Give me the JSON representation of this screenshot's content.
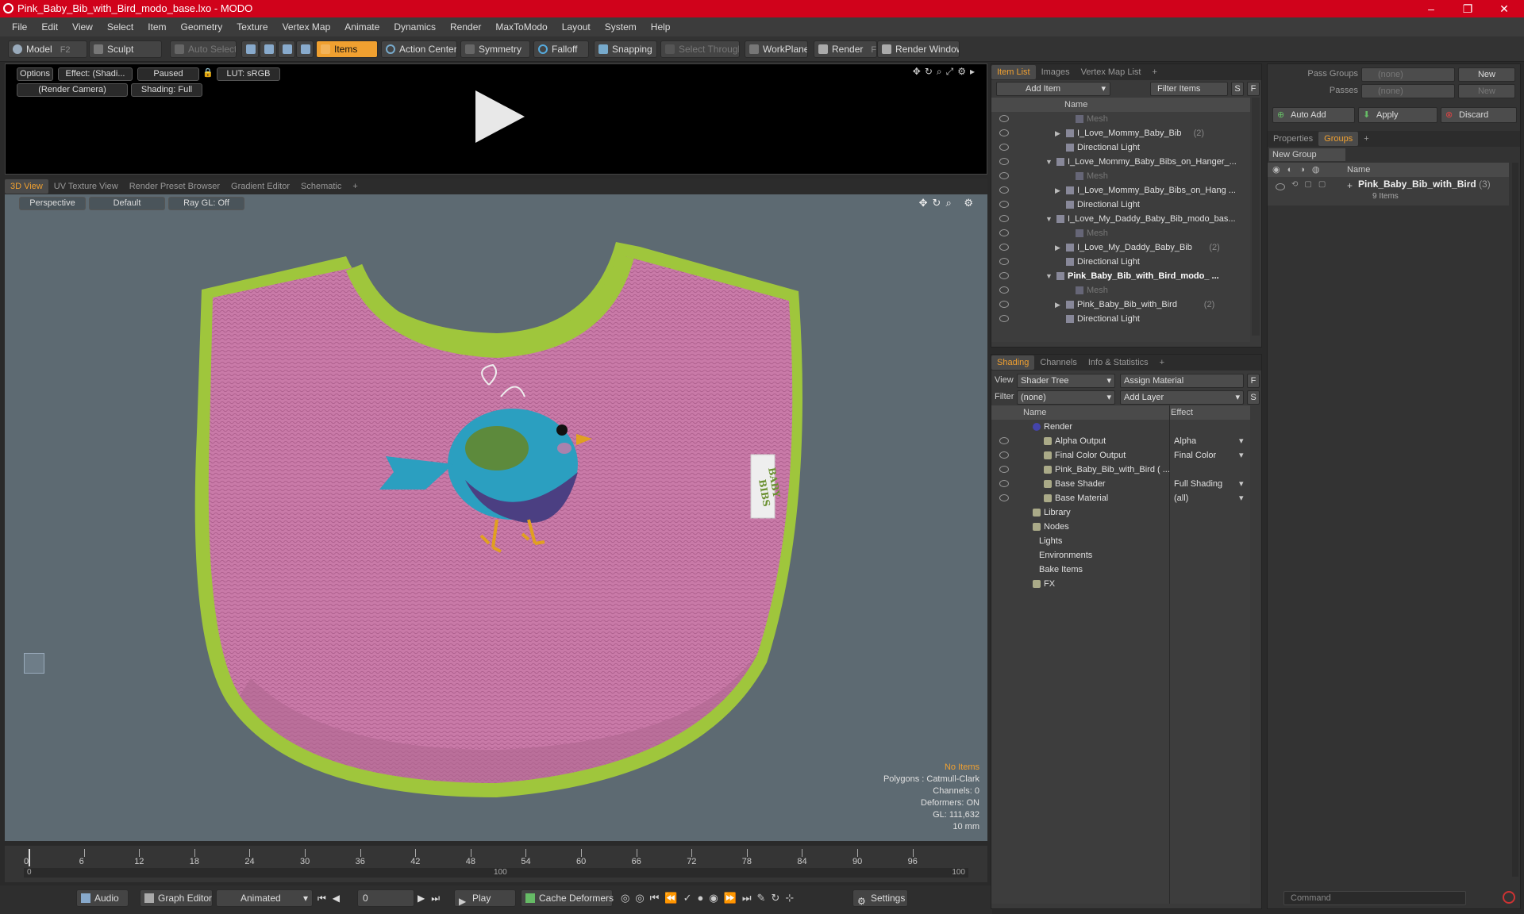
{
  "window": {
    "title": "Pink_Baby_Bib_with_Bird_modo_base.lxo - MODO"
  },
  "menu": [
    "File",
    "Edit",
    "View",
    "Select",
    "Item",
    "Geometry",
    "Texture",
    "Vertex Map",
    "Animate",
    "Dynamics",
    "Render",
    "MaxToModo",
    "Layout",
    "System",
    "Help"
  ],
  "toolbar": {
    "model": "Model",
    "model_key": "F2",
    "sculpt": "Sculpt",
    "auto_select": "Auto Select",
    "items": "Items",
    "action_center": "Action Center",
    "symmetry": "Symmetry",
    "falloff": "Falloff",
    "snapping": "Snapping",
    "select_through": "Select Through",
    "workplane": "WorkPlane",
    "render": "Render",
    "render_key": "F9",
    "render_window": "Render Window"
  },
  "preview": {
    "options": "Options",
    "effect": "Effect: (Shadi...",
    "paused": "Paused",
    "lut": "LUT: sRGB",
    "camera": "(Render Camera)",
    "shading": "Shading: Full"
  },
  "view_tabs": [
    "3D View",
    "UV Texture View",
    "Render Preset Browser",
    "Gradient Editor",
    "Schematic"
  ],
  "viewport": {
    "projection": "Perspective",
    "style": "Default",
    "raygl": "Ray GL: Off"
  },
  "bib": {
    "tag_line1": "BABY",
    "tag_line2": "BIBS",
    "bib_color": "#c97aa8",
    "trim_color": "#9fc63c",
    "bird_color": "#2b9fc0"
  },
  "hud": {
    "no_items": "No Items",
    "polygons": "Polygons : Catmull-Clark",
    "channels": "Channels: 0",
    "deformers": "Deformers: ON",
    "gl": "GL: 111,632",
    "scale": "10 mm"
  },
  "timeline": {
    "ticks": [
      "0",
      "6",
      "12",
      "18",
      "24",
      "30",
      "36",
      "42",
      "48",
      "54",
      "60",
      "66",
      "72",
      "78",
      "84",
      "90",
      "96"
    ],
    "start": "0",
    "mid": "100",
    "end": "100"
  },
  "bottom": {
    "audio": "Audio",
    "graph_editor": "Graph Editor",
    "animated": "Animated",
    "frame": "0",
    "play": "Play",
    "cache_deformers": "Cache Deformers",
    "settings": "Settings"
  },
  "item_list": {
    "tabs": [
      "Item List",
      "Images",
      "Vertex Map List"
    ],
    "add_item": "Add Item",
    "filter_items": "Filter Items",
    "s": "S",
    "f": "F",
    "col_name": "Name",
    "rows": [
      {
        "label": "Mesh",
        "dim": true,
        "indent": 3
      },
      {
        "label": "I_Love_Mommy_Baby_Bib",
        "count": "(2)",
        "indent": 2,
        "arrow": "▶"
      },
      {
        "label": "Directional Light",
        "indent": 2
      },
      {
        "label": "I_Love_Mommy_Baby_Bibs_on_Hanger_...",
        "indent": 1,
        "arrow": "▼"
      },
      {
        "label": "Mesh",
        "dim": true,
        "indent": 3
      },
      {
        "label": "I_Love_Mommy_Baby_Bibs_on_Hang ...",
        "indent": 2,
        "arrow": "▶"
      },
      {
        "label": "Directional Light",
        "indent": 2
      },
      {
        "label": "I_Love_My_Daddy_Baby_Bib_modo_bas...",
        "indent": 1,
        "arrow": "▼"
      },
      {
        "label": "Mesh",
        "dim": true,
        "indent": 3
      },
      {
        "label": "I_Love_My_Daddy_Baby_Bib",
        "count": "(2)",
        "indent": 2,
        "arrow": "▶"
      },
      {
        "label": "Directional Light",
        "indent": 2
      },
      {
        "label": "Pink_Baby_Bib_with_Bird_modo_ ...",
        "indent": 1,
        "arrow": "▼",
        "bold": true
      },
      {
        "label": "Mesh",
        "dim": true,
        "indent": 3
      },
      {
        "label": "Pink_Baby_Bib_with_Bird",
        "count": "(2)",
        "indent": 2,
        "arrow": "▶"
      },
      {
        "label": "Directional Light",
        "indent": 2
      }
    ]
  },
  "shading": {
    "tabs": [
      "Shading",
      "Channels",
      "Info & Statistics"
    ],
    "view_label": "View",
    "view_value": "Shader Tree",
    "assign_material": "Assign Material",
    "filter_label": "Filter",
    "filter_value": "(none)",
    "add_layer": "Add Layer",
    "col_name": "Name",
    "col_effect": "Effect",
    "rows": [
      {
        "label": "Render",
        "effect": "",
        "indent": 0
      },
      {
        "label": "Alpha Output",
        "effect": "Alpha",
        "indent": 1
      },
      {
        "label": "Final Color Output",
        "effect": "Final Color",
        "indent": 1
      },
      {
        "label": "Pink_Baby_Bib_with_Bird ( ...",
        "effect": "",
        "indent": 1
      },
      {
        "label": "Base Shader",
        "effect": "Full Shading",
        "indent": 1
      },
      {
        "label": "Base Material",
        "effect": "(all)",
        "indent": 1
      },
      {
        "label": "Library",
        "effect": "",
        "indent": 0
      },
      {
        "label": "Nodes",
        "effect": "",
        "indent": 0
      },
      {
        "label": "Lights",
        "effect": "",
        "indent": -1
      },
      {
        "label": "Environments",
        "effect": "",
        "indent": -1
      },
      {
        "label": "Bake Items",
        "effect": "",
        "indent": -1
      },
      {
        "label": "FX",
        "effect": "",
        "indent": 0
      }
    ]
  },
  "groups": {
    "pass_groups": "Pass Groups",
    "passes": "Passes",
    "none": "(none)",
    "new": "New",
    "auto_add": "Auto Add",
    "apply": "Apply",
    "discard": "Discard",
    "tabs": [
      "Properties",
      "Groups"
    ],
    "new_group": "New Group",
    "col_name": "Name",
    "group_name": "Pink_Baby_Bib_with_Bird",
    "group_count": "(3)",
    "group_items": "9 Items",
    "command": "Command"
  }
}
